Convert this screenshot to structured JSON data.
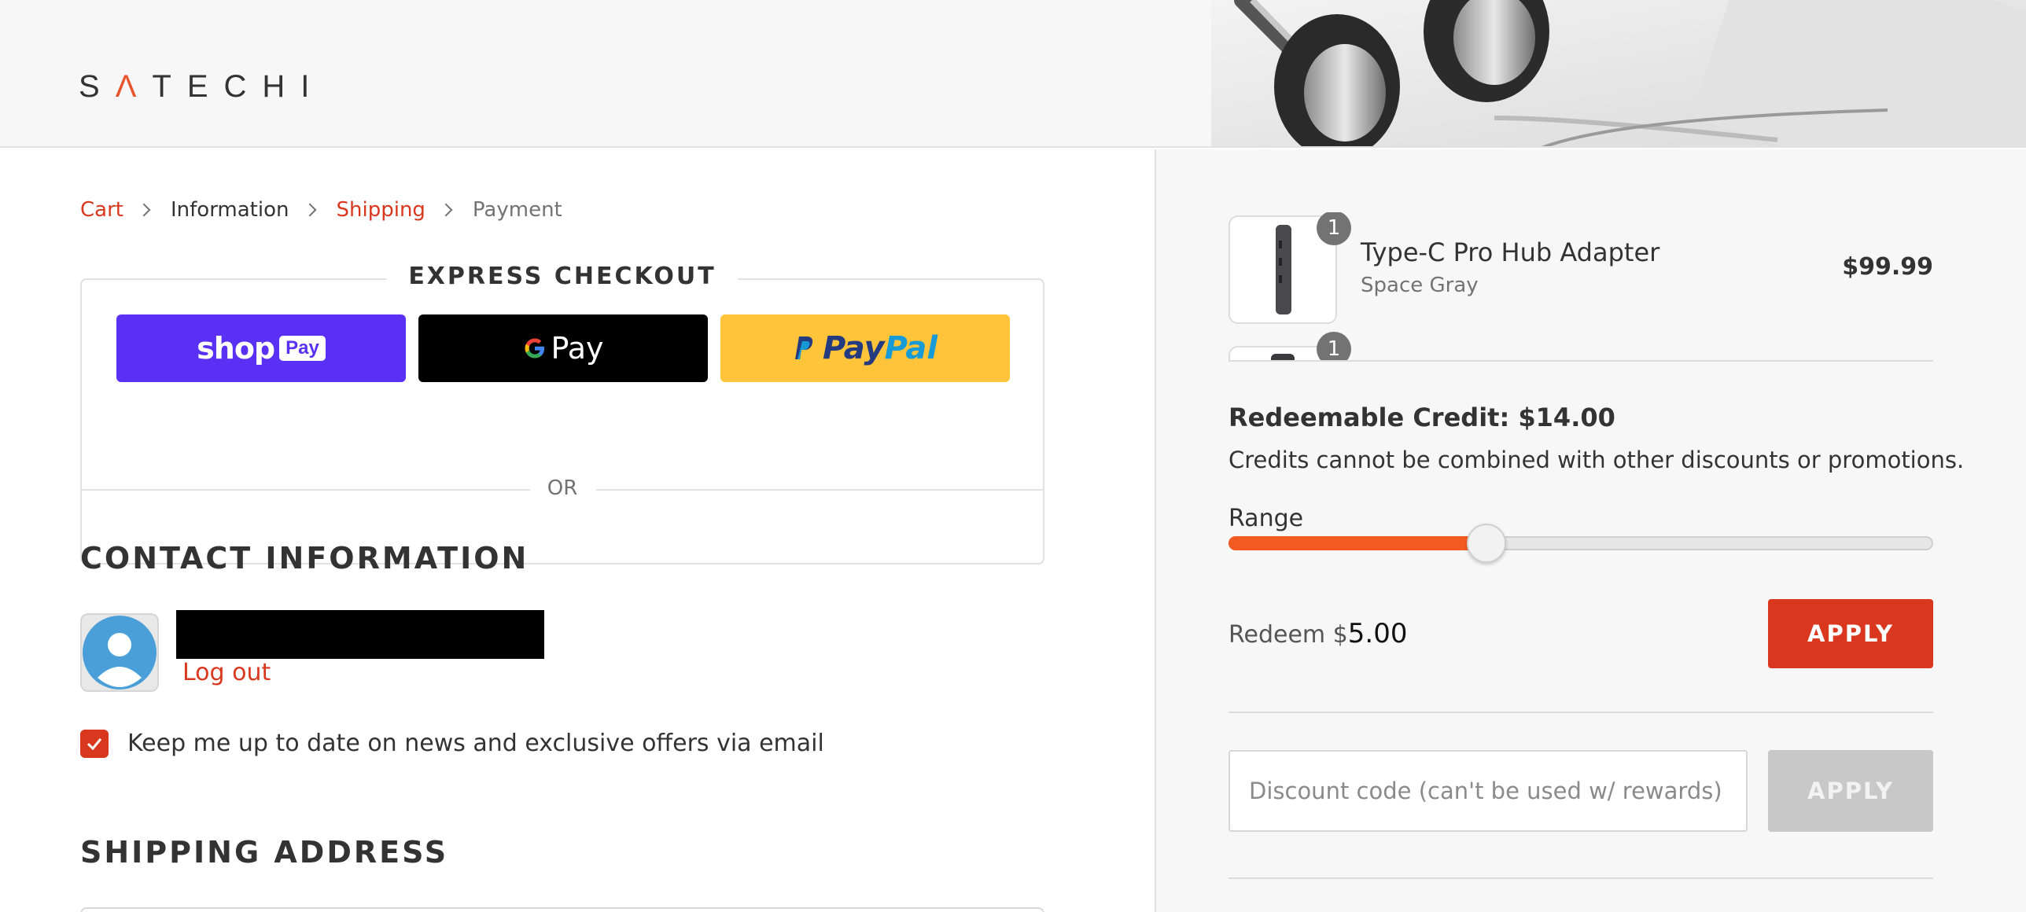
{
  "brand": {
    "logo_text_left": "S",
    "logo_text_accent": "Λ",
    "logo_text_right": "TECHI"
  },
  "breadcrumb": {
    "items": [
      {
        "label": "Cart",
        "state": "link"
      },
      {
        "label": "Information",
        "state": "current"
      },
      {
        "label": "Shipping",
        "state": "link"
      },
      {
        "label": "Payment",
        "state": "disabled"
      }
    ]
  },
  "express_checkout": {
    "title": "EXPRESS CHECKOUT",
    "shop_pay": {
      "label": "shop",
      "badge": "Pay"
    },
    "google_pay": {
      "label": "Pay"
    },
    "paypal": {
      "label_part1": "Pay",
      "label_part2": "Pal"
    }
  },
  "divider_or": "OR",
  "contact": {
    "title": "CONTACT INFORMATION",
    "logout_label": "Log out",
    "newsletter_label": "Keep me up to date on news and exclusive offers via email",
    "newsletter_checked": true
  },
  "shipping": {
    "title": "SHIPPING ADDRESS"
  },
  "order": {
    "items": [
      {
        "name": "Type-C Pro Hub Adapter",
        "variant": "Space Gray",
        "price": "$99.99",
        "quantity": "1"
      },
      {
        "quantity": "1"
      }
    ]
  },
  "rewards": {
    "credit_label": "Redeemable Credit: $14.00",
    "note": "Credits cannot be combined with other discounts or promotions.",
    "range_label": "Range",
    "range_fraction": 0.366,
    "redeem_prefix": "Redeem $",
    "redeem_amount": "5.00",
    "apply_label": "APPLY"
  },
  "discount": {
    "placeholder": "Discount code (can't be used w/ rewards)",
    "apply_label": "APPLY"
  },
  "colors": {
    "accent_red": "#d9381e",
    "slider_orange": "#f35a22",
    "shop_pay_purple": "#5a31f4",
    "paypal_yellow": "#ffc439"
  },
  "icons": {
    "breadcrumb_separator": "chevron-right-icon",
    "checkbox_mark": "checkmark-icon",
    "avatar": "user-avatar-icon"
  }
}
